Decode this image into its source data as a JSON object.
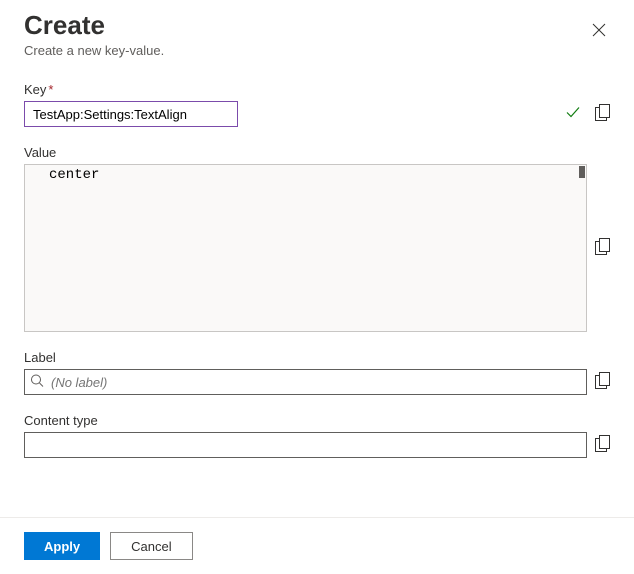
{
  "header": {
    "title": "Create",
    "subtitle": "Create a new key-value."
  },
  "fields": {
    "key": {
      "label": "Key",
      "value": "TestApp:Settings:TextAlign",
      "valid": true
    },
    "value": {
      "label": "Value",
      "text": "center"
    },
    "label_field": {
      "label": "Label",
      "placeholder": "(No label)"
    },
    "content_type": {
      "label": "Content type",
      "value": ""
    }
  },
  "footer": {
    "apply": "Apply",
    "cancel": "Cancel"
  }
}
